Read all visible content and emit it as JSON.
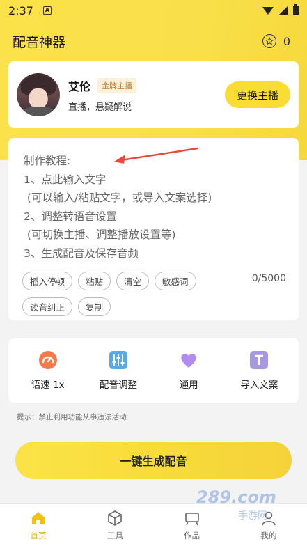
{
  "status": {
    "time": "2:37",
    "sim_label": "A"
  },
  "header": {
    "title": "配音神器",
    "coins": "0"
  },
  "anchor": {
    "name": "艾伦",
    "badge": "金牌主播",
    "description": "直播，悬疑解说",
    "change_button": "更换主播"
  },
  "editor": {
    "tutorial": "制作教程:\n1、点此输入文字\n (可以输入/粘贴文字，或导入文案选择)\n2、调整转语音设置\n (可切换主播、调整播放设置等)\n3、生成配音及保存音频",
    "chips": [
      "插入停顿",
      "粘贴",
      "清空",
      "敏感词",
      "读音纠正",
      "复制"
    ],
    "word_count": "0/5000"
  },
  "tools": [
    {
      "label": "语速 1x",
      "icon": "speedometer-icon",
      "color": "#f37a4a"
    },
    {
      "label": "配音调整",
      "icon": "sliders-icon",
      "color": "#5aa9e6"
    },
    {
      "label": "通用",
      "icon": "heart-icon",
      "color": "#b38bf0"
    },
    {
      "label": "导入文案",
      "icon": "text-import-icon",
      "color": "#a59adf"
    }
  ],
  "hint": "提示：禁止利用功能从事违法活动",
  "generate_button": "一键生成配音",
  "nav": [
    {
      "label": "首页",
      "icon": "home-icon",
      "active": true
    },
    {
      "label": "工具",
      "icon": "cube-icon",
      "active": false
    },
    {
      "label": "作品",
      "icon": "works-icon",
      "active": false
    },
    {
      "label": "我的",
      "icon": "profile-icon",
      "active": false
    }
  ],
  "watermark": {
    "main": "289.com",
    "sub": "手游网"
  },
  "colors": {
    "accent": "#f9dc34",
    "nav_active": "#e2b400",
    "badge_text": "#c0782f"
  }
}
